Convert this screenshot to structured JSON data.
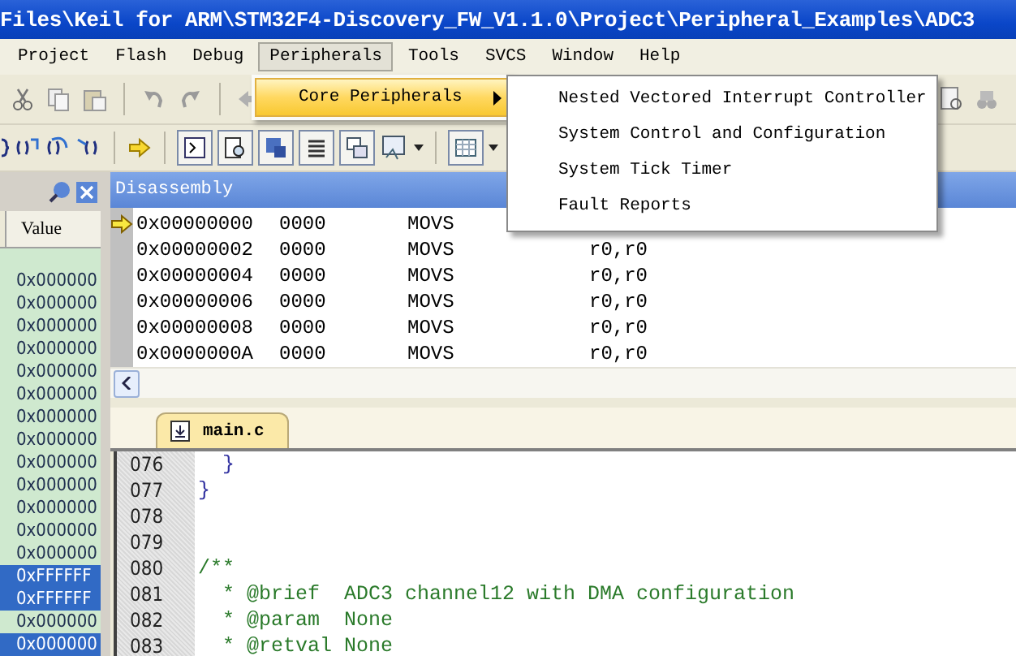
{
  "window": {
    "title": "Files\\Keil for ARM\\STM32F4-Discovery_FW_V1.1.0\\Project\\Peripheral_Examples\\ADC3"
  },
  "menu_bar": [
    {
      "label": "Project",
      "selected": false
    },
    {
      "label": "Flash",
      "selected": false
    },
    {
      "label": "Debug",
      "selected": false
    },
    {
      "label": "Peripherals",
      "selected": true
    },
    {
      "label": "Tools",
      "selected": false
    },
    {
      "label": "SVCS",
      "selected": false
    },
    {
      "label": "Window",
      "selected": false
    },
    {
      "label": "Help",
      "selected": false
    }
  ],
  "peripherals_menu": {
    "items": [
      {
        "label": "Core Peripherals",
        "selected": true,
        "expanded": true
      }
    ]
  },
  "core_peripherals_submenu": {
    "items": [
      {
        "label": "Nested Vectored Interrupt Controller"
      },
      {
        "label": "System Control and Configuration"
      },
      {
        "label": "System Tick Timer"
      },
      {
        "label": "Fault Reports"
      }
    ]
  },
  "watch_panel": {
    "columns": [
      "Value"
    ],
    "rows": [
      {
        "value": "0x000000",
        "selected": false
      },
      {
        "value": "0x000000",
        "selected": false
      },
      {
        "value": "0x000000",
        "selected": false
      },
      {
        "value": "0x000000",
        "selected": false
      },
      {
        "value": "0x000000",
        "selected": false
      },
      {
        "value": "0x000000",
        "selected": false
      },
      {
        "value": "0x000000",
        "selected": false
      },
      {
        "value": "0x000000",
        "selected": false
      },
      {
        "value": "0x000000",
        "selected": false
      },
      {
        "value": "0x000000",
        "selected": false
      },
      {
        "value": "0x000000",
        "selected": false
      },
      {
        "value": "0x000000",
        "selected": false
      },
      {
        "value": "0x000000",
        "selected": false
      },
      {
        "value": "0xFFFFFF",
        "selected": true
      },
      {
        "value": "0xFFFFFF",
        "selected": true
      },
      {
        "value": "0x000000",
        "selected": false
      },
      {
        "value": "0x000000",
        "selected": true
      }
    ]
  },
  "disassembly": {
    "title": "Disassembly",
    "rows": [
      {
        "address": "0x00000000",
        "opcode": "0000",
        "mnemonic": "MOVS",
        "current": true
      },
      {
        "address": "0x00000002",
        "opcode": "0000",
        "mnemonic": "MOVS",
        "operands": "r0,r0",
        "current": false
      },
      {
        "address": "0x00000004",
        "opcode": "0000",
        "mnemonic": "MOVS",
        "operands": "r0,r0",
        "current": false
      },
      {
        "address": "0x00000006",
        "opcode": "0000",
        "mnemonic": "MOVS",
        "operands": "r0,r0",
        "current": false
      },
      {
        "address": "0x00000008",
        "opcode": "0000",
        "mnemonic": "MOVS",
        "operands": "r0,r0",
        "current": false
      },
      {
        "address": "0x0000000A",
        "opcode": "0000",
        "mnemonic": "MOVS",
        "operands": "r0,r0",
        "current": false
      }
    ]
  },
  "editor": {
    "tabs": [
      {
        "label": "main.c",
        "selected": true
      }
    ],
    "lines": [
      {
        "number": "076",
        "kind": "code",
        "text": "  }"
      },
      {
        "number": "077",
        "kind": "code",
        "text": "}"
      },
      {
        "number": "078",
        "kind": "code"
      },
      {
        "number": "079",
        "kind": "code"
      },
      {
        "number": "080",
        "kind": "comment",
        "text": "/**"
      },
      {
        "number": "081",
        "kind": "comment",
        "text": "  * @brief  ADC3 channel12 with DMA configuration"
      },
      {
        "number": "082",
        "kind": "comment",
        "text": "  * @param  None"
      },
      {
        "number": "083",
        "kind": "comment",
        "text": "  * @retval None"
      }
    ]
  }
}
